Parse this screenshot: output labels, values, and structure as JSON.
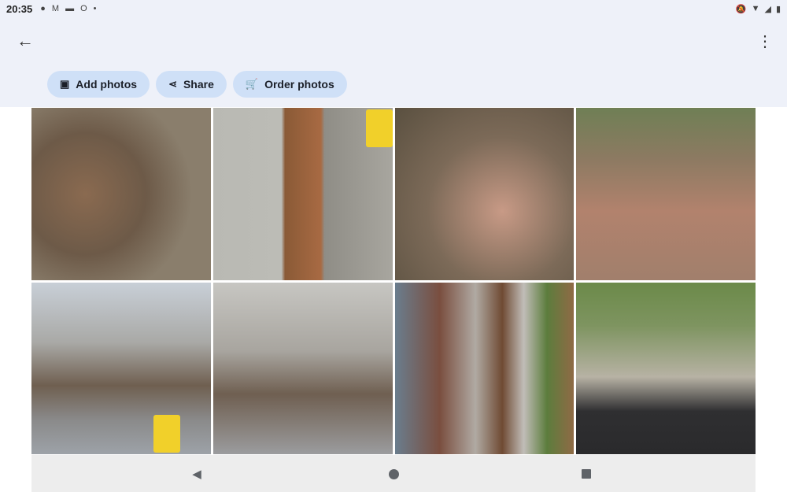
{
  "status_bar": {
    "time": "20:35",
    "left_icons": [
      "chat-icon",
      "gmail-icon",
      "battery-saver-icon",
      "opera-icon",
      "dot-icon"
    ],
    "right_icons": [
      "notifications-off-icon",
      "wifi-icon",
      "signal-icon",
      "battery-icon"
    ]
  },
  "app_bar": {
    "back_icon": "arrow-back-icon",
    "menu_icon": "more-vert-icon",
    "actions": [
      {
        "label": "Add photos",
        "icon": "add-photo-icon"
      },
      {
        "label": "Share",
        "icon": "share-icon"
      },
      {
        "label": "Order photos",
        "icon": "cart-icon"
      }
    ]
  },
  "photos": [
    {
      "name": "photo-trench-dirt"
    },
    {
      "name": "photo-person-concrete"
    },
    {
      "name": "photo-rocks-red-soil"
    },
    {
      "name": "photo-yard-trees"
    },
    {
      "name": "photo-pool-equipment-blocks"
    },
    {
      "name": "photo-pool-equipment-wall"
    },
    {
      "name": "photo-house-trench-bricks"
    },
    {
      "name": "photo-patio-ac-unit"
    }
  ],
  "nav_bar": {
    "back": "nav-back-icon",
    "home": "nav-home-icon",
    "recents": "nav-recents-icon"
  },
  "colors": {
    "app_bar_bg": "#eef1f9",
    "chip_bg": "#cfe0f7",
    "text": "#1b1f28"
  }
}
